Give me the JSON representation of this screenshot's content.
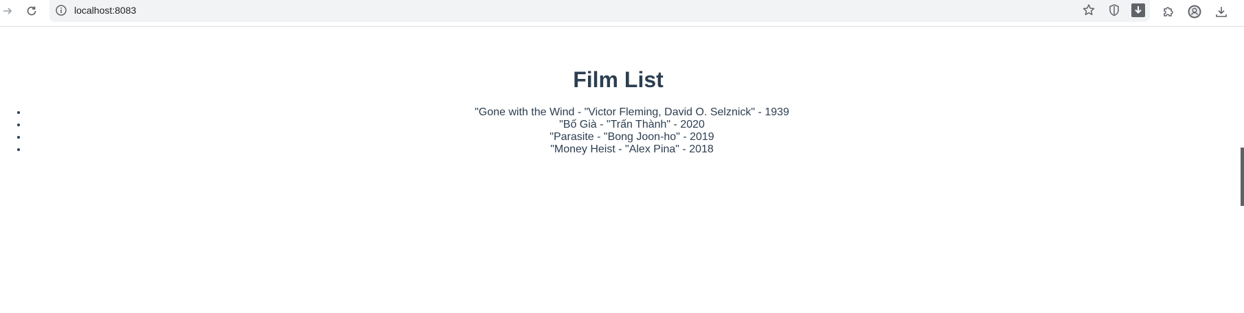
{
  "browser": {
    "url": "localhost:8083",
    "icons": [
      "forward-icon",
      "reload-icon",
      "site-info-icon",
      "bookmark-star-icon",
      "shield-extension-icon",
      "download-extension-icon",
      "extensions-puzzle-icon",
      "profile-icon",
      "downloads-icon"
    ]
  },
  "page": {
    "title": "Film List",
    "films": [
      "\"Gone with the Wind - \"Victor Fleming, David O. Selznick\" - 1939",
      "\"Bố Già - \"Trấn Thành\" - 2020",
      "\"Parasite - \"Bong Joon-ho\" - 2019",
      "\"Money Heist - \"Alex Pina\" - 2018"
    ]
  },
  "colors": {
    "text": "#2c3e50",
    "toolbar_bg": "#f1f3f4",
    "icon": "#5f6368"
  }
}
